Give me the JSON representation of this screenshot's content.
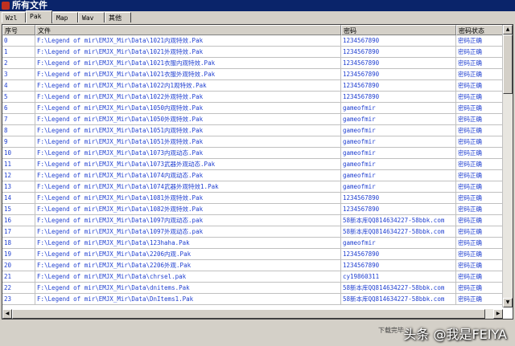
{
  "window": {
    "title": "所有文件"
  },
  "tabs": [
    "Wzl",
    "Pak",
    "Map",
    "Wav",
    "其他"
  ],
  "active_tab": "Pak",
  "table": {
    "headers": [
      "序号",
      "文件",
      "密码",
      "密码状态"
    ],
    "rows": [
      [
        "0",
        "F:\\Legend of mir\\EMJX_Mir\\Data\\1021内观特效.Pak",
        "1234567890",
        "密码正确"
      ],
      [
        "1",
        "F:\\Legend of mir\\EMJX_Mir\\Data\\1021外观特效.Pak",
        "1234567890",
        "密码正确"
      ],
      [
        "2",
        "F:\\Legend of mir\\EMJX_Mir\\Data\\1021衣服内观特效.Pak",
        "1234567890",
        "密码正确"
      ],
      [
        "3",
        "F:\\Legend of mir\\EMJX_Mir\\Data\\1021衣服外观特效.Pak",
        "1234567890",
        "密码正确"
      ],
      [
        "4",
        "F:\\Legend of mir\\EMJX_Mir\\Data\\1022内1观特效.Pak",
        "1234567890",
        "密码正确"
      ],
      [
        "5",
        "F:\\Legend of mir\\EMJX_Mir\\Data\\1022外观特效.Pak",
        "1234567890",
        "密码正确"
      ],
      [
        "6",
        "F:\\Legend of mir\\EMJX_Mir\\Data\\1050内观特效.Pak",
        "gameofmir",
        "密码正确"
      ],
      [
        "7",
        "F:\\Legend of mir\\EMJX_Mir\\Data\\1050外观特效.Pak",
        "gameofmir",
        "密码正确"
      ],
      [
        "8",
        "F:\\Legend of mir\\EMJX_Mir\\Data\\1051内观特效.Pak",
        "gameofmir",
        "密码正确"
      ],
      [
        "9",
        "F:\\Legend of mir\\EMJX_Mir\\Data\\1051外观特效.Pak",
        "gameofmir",
        "密码正确"
      ],
      [
        "10",
        "F:\\Legend of mir\\EMJX_Mir\\Data\\1073内观动态.Pak",
        "gameofmir",
        "密码正确"
      ],
      [
        "11",
        "F:\\Legend of mir\\EMJX_Mir\\Data\\1073武器外观动态.Pak",
        "gameofmir",
        "密码正确"
      ],
      [
        "12",
        "F:\\Legend of mir\\EMJX_Mir\\Data\\1074内观动态.Pak",
        "gameofmir",
        "密码正确"
      ],
      [
        "13",
        "F:\\Legend of mir\\EMJX_Mir\\Data\\1074武器外观特效1.Pak",
        "gameofmir",
        "密码正确"
      ],
      [
        "14",
        "F:\\Legend of mir\\EMJX_Mir\\Data\\1081外观特效.Pak",
        "1234567890",
        "密码正确"
      ],
      [
        "15",
        "F:\\Legend of mir\\EMJX_Mir\\Data\\1082外观特效.Pak",
        "1234567890",
        "密码正确"
      ],
      [
        "16",
        "F:\\Legend of mir\\EMJX_Mir\\Data\\1097内观动态.pak",
        "58新本库QQ814634227-58bbk.com",
        "密码正确"
      ],
      [
        "17",
        "F:\\Legend of mir\\EMJX_Mir\\Data\\1097外观动态.pak",
        "58新本库QQ814634227-58bbk.com",
        "密码正确"
      ],
      [
        "18",
        "F:\\Legend of mir\\EMJX_Mir\\Data\\123haha.Pak",
        "gameofmir",
        "密码正确"
      ],
      [
        "19",
        "F:\\Legend of mir\\EMJX_Mir\\Data\\2206内观.Pak",
        "1234567890",
        "密码正确"
      ],
      [
        "20",
        "F:\\Legend of mir\\EMJX_Mir\\Data\\2206外观.Pak",
        "1234567890",
        "密码正确"
      ],
      [
        "21",
        "F:\\Legend of mir\\EMJX_Mir\\Data\\chrsel.pak",
        "cy19860311",
        "密码正确"
      ],
      [
        "22",
        "F:\\Legend of mir\\EMJX_Mir\\Data\\dnitems.Pak",
        "58新本库QQ814634227-58bbk.com",
        "密码正确"
      ],
      [
        "23",
        "F:\\Legend of mir\\EMJX_Mir\\Data\\DnItems1.Pak",
        "58新本库QQ814634227-58bbk.com",
        "密码正确"
      ]
    ]
  },
  "status": {
    "text": "下载完毕"
  },
  "watermark": "头条 @我是FEIYA",
  "colors": {
    "title_bar": "#0a246a",
    "row_text": "#1f3fd0",
    "chrome": "#d4d0c8"
  }
}
